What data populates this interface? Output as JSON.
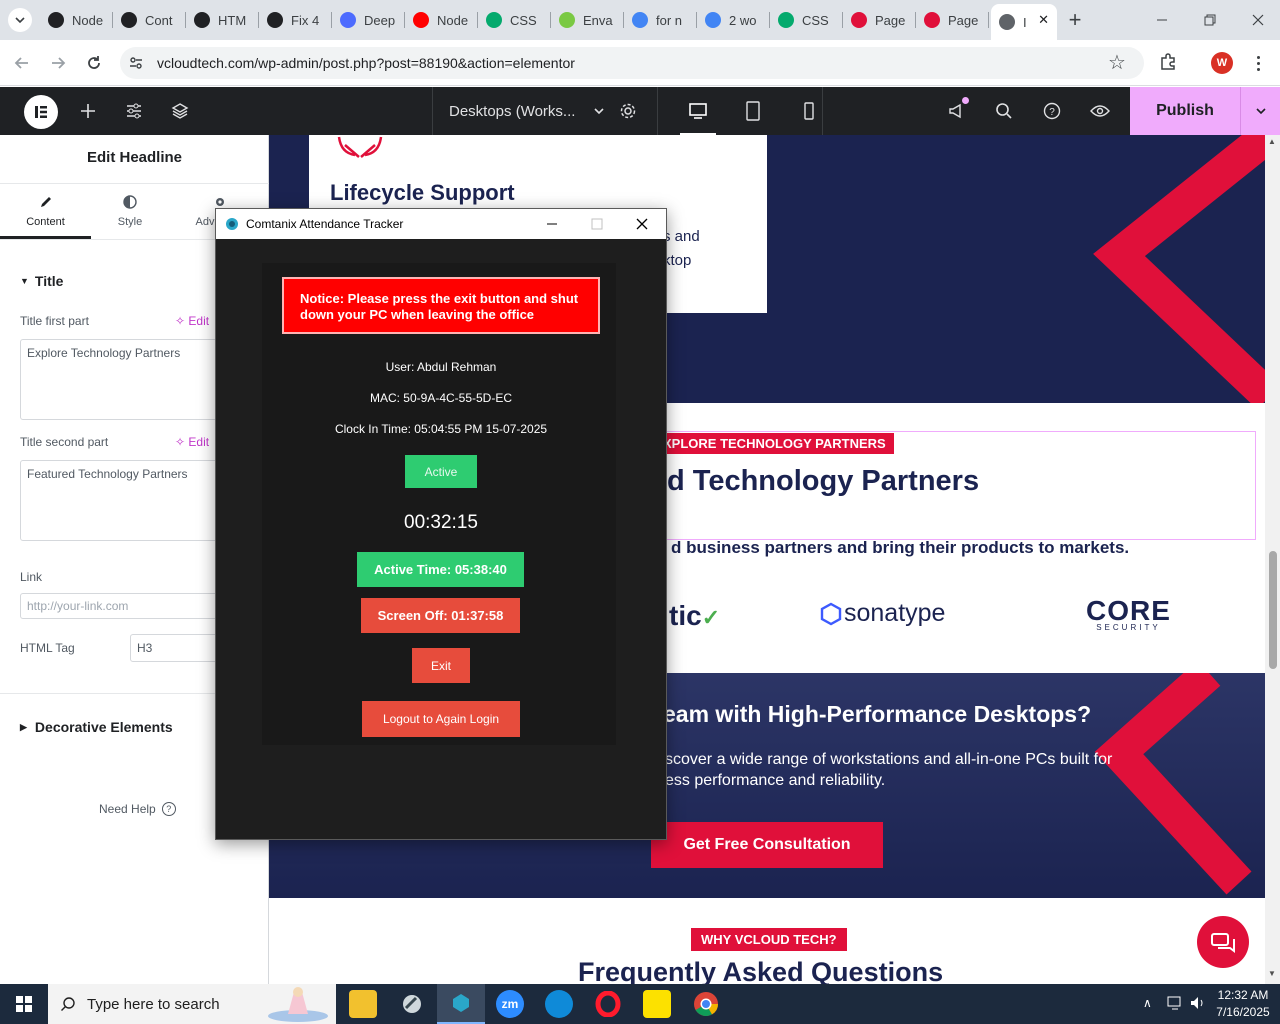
{
  "browser": {
    "tabs": [
      {
        "label": "Node",
        "icon": "openai-icon",
        "color": "#202124"
      },
      {
        "label": "Cont",
        "icon": "openai-icon",
        "color": "#202124"
      },
      {
        "label": "HTM",
        "icon": "openai-icon",
        "color": "#202124"
      },
      {
        "label": "Fix 4",
        "icon": "openai-icon",
        "color": "#202124"
      },
      {
        "label": "Deep",
        "icon": "deepseek-icon",
        "color": "#4d6bfe"
      },
      {
        "label": "Node",
        "icon": "youtube-icon",
        "color": "#ff0000"
      },
      {
        "label": "CSS",
        "icon": "w3schools-icon",
        "color": "#04aa6d"
      },
      {
        "label": "Enva",
        "icon": "envato-icon",
        "color": "#7ac943"
      },
      {
        "label": "for n",
        "icon": "google-icon",
        "color": "#4285f4"
      },
      {
        "label": "2 wo",
        "icon": "google-icon",
        "color": "#4285f4"
      },
      {
        "label": "CSS",
        "icon": "w3schools-icon",
        "color": "#04aa6d"
      },
      {
        "label": "Page",
        "icon": "elementor-page-icon",
        "color": "#e0103a"
      },
      {
        "label": "Page",
        "icon": "elementor-page-icon",
        "color": "#e0103a"
      },
      {
        "label": "I",
        "icon": "globe-icon",
        "color": "#5f6368"
      }
    ],
    "url": "vcloudtech.com/wp-admin/post.php?post=88190&action=elementor",
    "profile_initial": "W"
  },
  "elementor": {
    "device_label": "Desktops (Works...",
    "publish_label": "Publish",
    "panel": {
      "title": "Edit Headline",
      "tabs": [
        "Content",
        "Style",
        "Adv"
      ],
      "section_title": "Title",
      "title_first_label": "Title first part",
      "title_first_value": "Explore Technology Partners",
      "title_second_label": "Title second part",
      "title_second_value": "Featured Technology Partners",
      "edit_ai_label": "Edit",
      "link_label": "Link",
      "link_placeholder": "http://your-link.com",
      "html_tag_label": "HTML Tag",
      "html_tag_value": "H3",
      "decorative_label": "Decorative Elements",
      "need_help": "Need Help"
    }
  },
  "site": {
    "card_title": "Lifecycle Support",
    "card_text_1": "s and",
    "card_text_2": "ktop",
    "explore_badge": "XPLORE TECHNOLOGY PARTNERS",
    "partners_heading": "d Technology Partners",
    "partners_sub": "d business partners and bring their products to markets.",
    "logo_1": "tic",
    "logo_2": "sonatype",
    "logo_3_main": "CORE",
    "logo_3_sub": "SECURITY",
    "cta_heading": "eam with High-Performance Desktops?",
    "cta_text_1": "scover a wide range of workstations and all-in-one PCs built for",
    "cta_text_2": "ess performance and reliability.",
    "cta_button": "Get Free Consultation",
    "why_badge": "WHY VCLOUD TECH?",
    "faq_heading": "Frequently Asked Questions"
  },
  "tracker": {
    "title": "Comtanix Attendance Tracker",
    "notice": "Notice: Please press the exit button and shut down your PC when leaving the office",
    "user": "User: Abdul Rehman",
    "mac": "MAC: 50-9A-4C-55-5D-EC",
    "clock_in": "Clock In Time: 05:04:55 PM 15-07-2025",
    "status": "Active",
    "timer": "00:32:15",
    "active_time": "Active Time: 05:38:40",
    "screen_off": "Screen Off: 01:37:58",
    "exit": "Exit",
    "logout": "Logout to Again Login"
  },
  "taskbar": {
    "search_placeholder": "Type here to search",
    "time": "12:32 AM",
    "date": "7/16/2025"
  },
  "colors": {
    "navy": "#1b2350",
    "brand_red": "#e0103a",
    "accent_pink": "#f0abfc",
    "tracker_green": "#2ecc71",
    "tracker_red": "#e74c3c",
    "notice_red": "#ff0000"
  }
}
